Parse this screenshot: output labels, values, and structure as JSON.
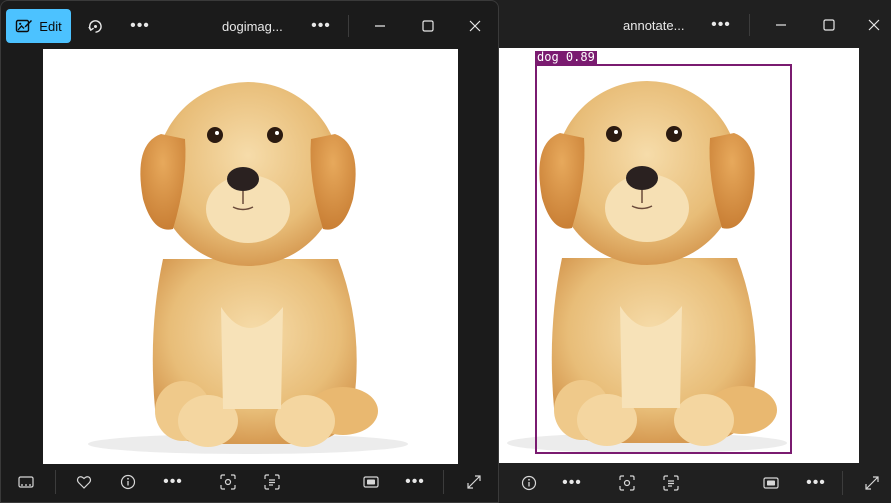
{
  "left_window": {
    "edit_label": "Edit",
    "title": "dogimag...",
    "more_label": "•••",
    "toolbar_more_label": "•••"
  },
  "right_window": {
    "title": "annotate...",
    "more_label": "•••",
    "toolbar_more_label": "•••",
    "detection": {
      "label": "dog",
      "confidence": "0.89",
      "label_text": "dog 0.89",
      "box_color": "#7a1b70"
    }
  },
  "colors": {
    "accent": "#4cc2ff",
    "window_bg": "#1c1c1c",
    "icon": "#e8e8e8",
    "detection_box": "#7a1b70"
  }
}
